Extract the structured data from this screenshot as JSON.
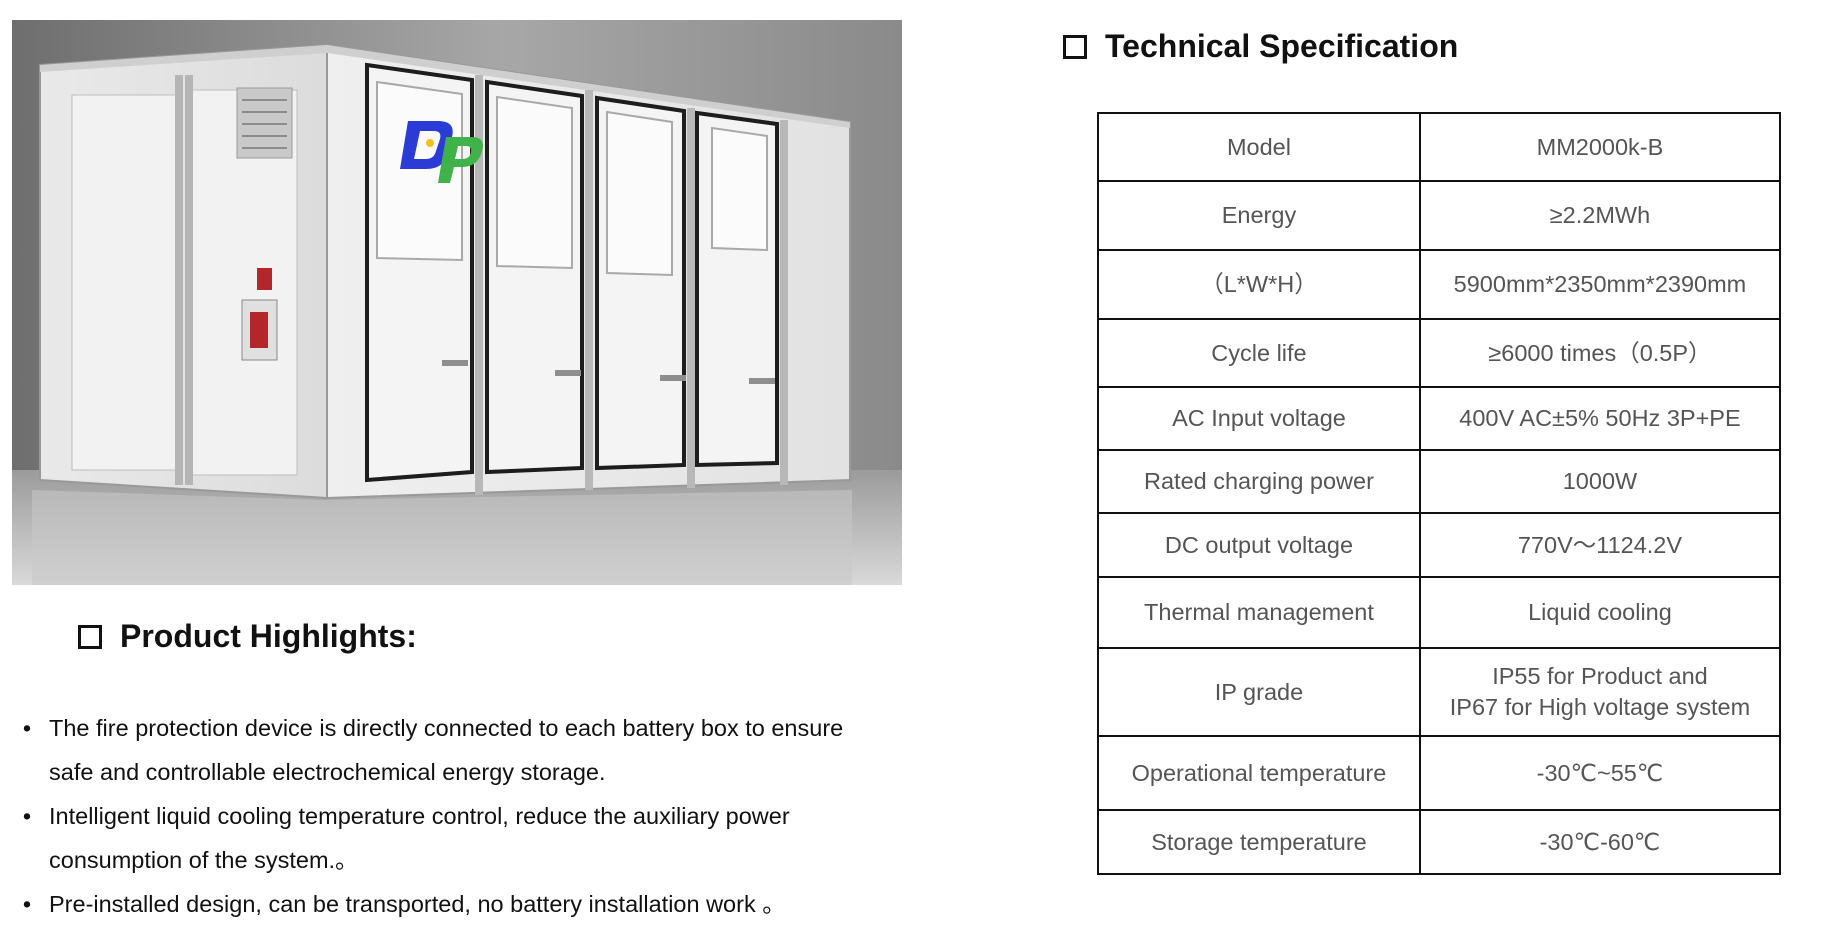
{
  "photo": {
    "icon": "battery-storage-container-photo",
    "logo_text": "DP",
    "logo_colors": {
      "primary": "#2a3bd6",
      "secondary": "#3fb24a",
      "accent": "#f2c21a"
    }
  },
  "spec": {
    "heading": "Technical Specification",
    "rows": [
      {
        "key": "Model",
        "value": "MM2000k-B"
      },
      {
        "key": "Energy",
        "value": "≥2.2MWh"
      },
      {
        "key": "（L*W*H）",
        "value": "5900mm*2350mm*2390mm"
      },
      {
        "key": "Cycle life",
        "value": "≥6000 times（0.5P）"
      },
      {
        "key": "AC Input voltage",
        "value": "400V AC±5% 50Hz 3P+PE"
      },
      {
        "key": "Rated charging power",
        "value": "1000W"
      },
      {
        "key": "DC output voltage",
        "value": "770V～1124.2V"
      },
      {
        "key": "Thermal management",
        "value": "Liquid cooling"
      },
      {
        "key": "IP grade",
        "value": "IP55 for Product and",
        "value2": "IP67 for High voltage system"
      },
      {
        "key": "Operational temperature",
        "value": "-30℃~55℃"
      },
      {
        "key": "Storage temperature",
        "value": "-30℃-60℃"
      }
    ]
  },
  "highlights": {
    "heading": "Product Highlights:",
    "bullet": "•",
    "items": [
      {
        "line1": "The fire protection device is directly connected to each battery box to ensure",
        "line2": "safe and controllable electrochemical energy storage."
      },
      {
        "line1": "Intelligent liquid cooling temperature control, reduce the auxiliary power",
        "line2": "consumption of the system.。"
      },
      {
        "line1": "Pre-installed design, can be transported, no battery installation work 。",
        "line2": ""
      }
    ]
  }
}
